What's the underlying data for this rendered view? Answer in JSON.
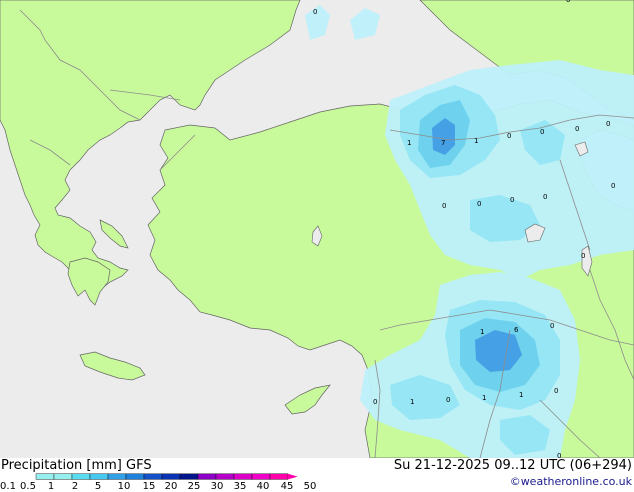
{
  "title": "Precipitation [mm]",
  "model": "GFS",
  "run": "Su 21-12-2025 09..12 UTC (06+294)",
  "credit": "©weatheronline.co.uk",
  "legend": {
    "ticks": [
      "0.1",
      "0.5",
      "1",
      "2",
      "5",
      "10",
      "15",
      "20",
      "25",
      "30",
      "35",
      "40",
      "45",
      "50"
    ],
    "colors": [
      "#96f0f0",
      "#96f0f0",
      "#5adcf0",
      "#46c8f0",
      "#32a0e6",
      "#1e82dc",
      "#1450c8",
      "#0a32b4",
      "#00148c",
      "#8c00c8",
      "#b400c8",
      "#dc00c8",
      "#f000c8",
      "#ff00aa"
    ]
  },
  "colors": {
    "sea": "#ececec",
    "land": "#c8fa9b",
    "border": "#8c8c8c",
    "coast": "#646464",
    "precip_light": "#bef0fa",
    "precip_1": "#96e6f5",
    "precip_2": "#6ed2ee",
    "precip_5": "#46a0e6"
  },
  "map_labels": [
    "0",
    "1",
    "7",
    "1",
    "0",
    "0",
    "0",
    "0",
    "0",
    "0",
    "0",
    "0",
    "0",
    "0",
    "0",
    "1",
    "6",
    "0",
    "0",
    "1",
    "0",
    "1",
    "1",
    "0",
    "0"
  ]
}
